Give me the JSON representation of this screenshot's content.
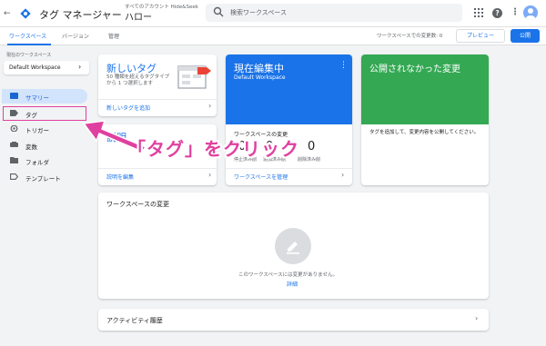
{
  "header": {
    "back_icon": "arrow-left-icon",
    "app_title": "タグ マネージャー",
    "account_breadcrumb": "すべてのアカウント Hide&Seek",
    "container_name": "ハロー",
    "search_placeholder": "検索ワークスペース",
    "icons": [
      "apps-icon",
      "help-icon",
      "more-vert-icon",
      "avatar"
    ]
  },
  "tabs": {
    "workspace": "ワークスペース",
    "versions": "バージョン",
    "admin": "管理"
  },
  "toolbar": {
    "changes_text": "ワークスペースでの変更数: 0",
    "preview_label": "プレビュー",
    "publish_label": "公開"
  },
  "sidebar": {
    "ws_label": "現在のワークスペース",
    "ws_value": "Default Workspace",
    "items": [
      {
        "label": "サマリー",
        "icon": "summary-icon",
        "selected": true
      },
      {
        "label": "タグ",
        "icon": "tag-icon",
        "selected": false
      },
      {
        "label": "トリガー",
        "icon": "trigger-icon",
        "selected": false
      },
      {
        "label": "変数",
        "icon": "variable-icon",
        "selected": false
      },
      {
        "label": "フォルダ",
        "icon": "folder-icon",
        "selected": false
      },
      {
        "label": "テンプレート",
        "icon": "template-icon",
        "selected": false
      }
    ]
  },
  "cards": {
    "new_tag": {
      "title": "新しいタグ",
      "desc": "50 種類を超えるタグタイプから 1 つ選択します",
      "link": "新しいタグを追加"
    },
    "description": {
      "title": "説明",
      "link": "説明を編集"
    },
    "editing": {
      "title": "現在編集中",
      "workspace": "Default Workspace",
      "changes_title": "ワークスペースの変更",
      "count_added": "0",
      "count_edited": "0",
      "count_deleted": "0",
      "label_added": "停止済み削",
      "label_edited": "追加済み削",
      "label_deleted": "削除済み削",
      "link": "ワークスペースを管理"
    },
    "unpublished": {
      "title": "公開されなかった変更",
      "desc": "タグを追加して、変更内容を公開してください。"
    },
    "workspace_changes": {
      "title": "ワークスペースの変更",
      "empty_text": "このワークスペースには変更がありません。",
      "link": "詳細"
    },
    "activity": {
      "title": "アクティビティ履歴"
    }
  },
  "annotation": {
    "text": "「タグ」をクリック",
    "color": "#e040a0"
  },
  "colors": {
    "primary": "#1a73e8",
    "green": "#34a853",
    "red": "#ea4335"
  }
}
